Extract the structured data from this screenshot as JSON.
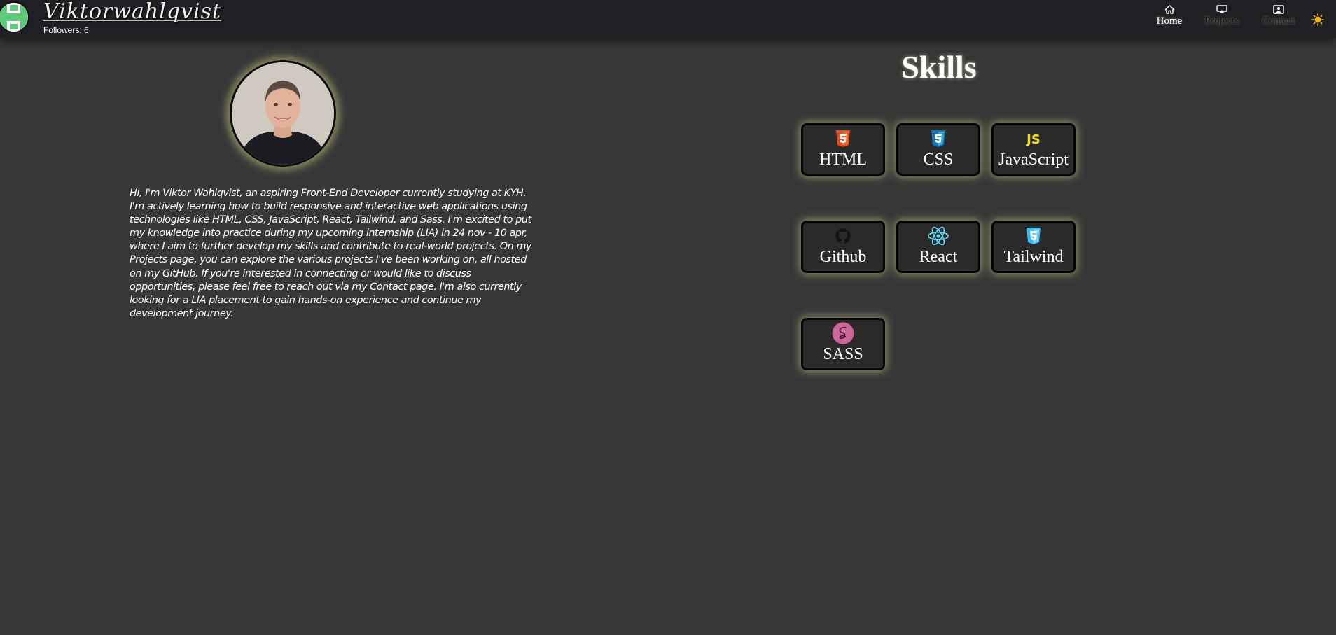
{
  "header": {
    "brand": "Viktorwahlqvist",
    "followers": "Followers: 6",
    "avatar_icon": "github-identicon-icon",
    "nav": [
      {
        "label": "Home",
        "icon": "home-icon"
      },
      {
        "label": "Projects",
        "icon": "projects-icon"
      },
      {
        "label": "Contact",
        "icon": "contact-icon"
      }
    ],
    "theme_toggle_icon": "sun-icon"
  },
  "about": {
    "photo": "profile-photo",
    "bio": "Hi, I'm Viktor Wahlqvist, an aspiring Front-End Developer currently studying at KYH. I'm actively learning how to build responsive and interactive web applications using technologies like HTML, CSS, JavaScript, React, Tailwind, and Sass. I'm excited to put my knowledge into practice during my upcoming internship (LIA) in 24 nov - 10 apr, where I aim to further develop my skills and contribute to real-world projects. On my Projects page, you can explore the various projects I've been working on, all hosted on my GitHub. If you're interested in connecting or would like to discuss opportunities, please feel free to reach out via my Contact page. I'm also currently looking for a LIA placement to gain hands-on experience and continue my development journey."
  },
  "skills": {
    "title": "Skills",
    "items": [
      {
        "label": "HTML",
        "icon": "html5-icon",
        "color": "#e44d26"
      },
      {
        "label": "CSS",
        "icon": "css3-icon",
        "color": "#1572b6"
      },
      {
        "label": "JavaScript",
        "icon": "javascript-icon",
        "color": "#f7df1e"
      },
      {
        "label": "Github",
        "icon": "github-icon",
        "color": "#181717"
      },
      {
        "label": "React",
        "icon": "react-icon",
        "color": "#61dafb"
      },
      {
        "label": "Tailwind",
        "icon": "tailwind-icon",
        "color": "#38bdf8"
      },
      {
        "label": "SASS",
        "icon": "sass-icon",
        "color": "#cc6699"
      }
    ]
  },
  "colors": {
    "background": "#373737",
    "navbar": "#1f2023",
    "card": "#2a2a2a",
    "glow": "#e6eb96"
  }
}
